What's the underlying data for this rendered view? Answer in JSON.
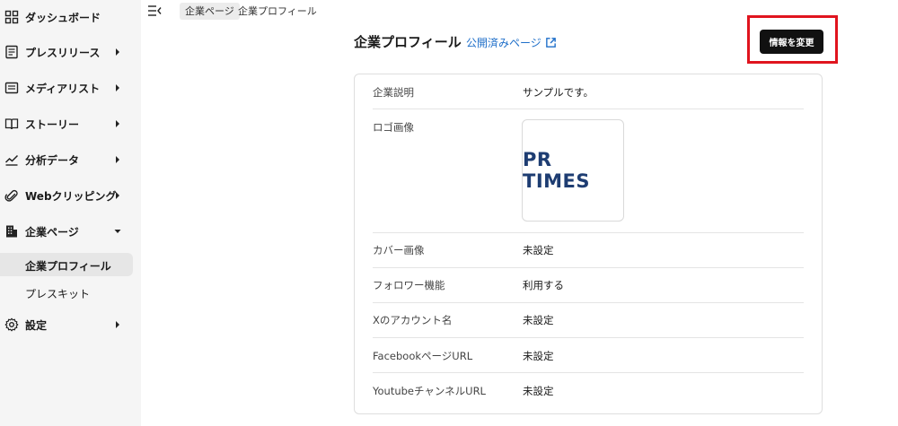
{
  "sidebar": {
    "items": [
      {
        "label": "ダッシュボード",
        "icon": "dashboard-icon",
        "has_chevron": false
      },
      {
        "label": "プレスリリース",
        "icon": "press-release-icon",
        "has_chevron": true
      },
      {
        "label": "メディアリスト",
        "icon": "media-list-icon",
        "has_chevron": true
      },
      {
        "label": "ストーリー",
        "icon": "book-icon",
        "has_chevron": true
      },
      {
        "label": "分析データ",
        "icon": "analytics-icon",
        "has_chevron": true
      },
      {
        "label": "Webクリッピング",
        "icon": "paperclip-icon",
        "has_chevron": true
      },
      {
        "label": "企業ページ",
        "icon": "building-icon",
        "has_chevron": true,
        "expanded": true
      },
      {
        "label": "設定",
        "icon": "gear-icon",
        "has_chevron": true
      }
    ],
    "sub_items": [
      {
        "label": "企業プロフィール",
        "active": true
      },
      {
        "label": "プレスキット",
        "active": false
      }
    ]
  },
  "breadcrumb": {
    "parent": "企業ページ",
    "current": "企業プロフィール"
  },
  "header": {
    "title": "企業プロフィール",
    "public_link": "公開済みページ",
    "edit_button": "情報を変更"
  },
  "profile": {
    "rows": [
      {
        "label": "企業説明",
        "value": "サンプルです。"
      },
      {
        "label": "ロゴ画像",
        "value": ""
      },
      {
        "label": "カバー画像",
        "value": "未設定"
      },
      {
        "label": "フォロワー機能",
        "value": "利用する"
      },
      {
        "label": "Xのアカウント名",
        "value": "未設定"
      },
      {
        "label": "FacebookページURL",
        "value": "未設定"
      },
      {
        "label": "YoutubeチャンネルURL",
        "value": "未設定"
      }
    ],
    "logo_text": "PR TIMES"
  },
  "colors": {
    "accent_link": "#1f6fc9",
    "highlight": "#e0141e",
    "logo": "#1e3d72"
  }
}
